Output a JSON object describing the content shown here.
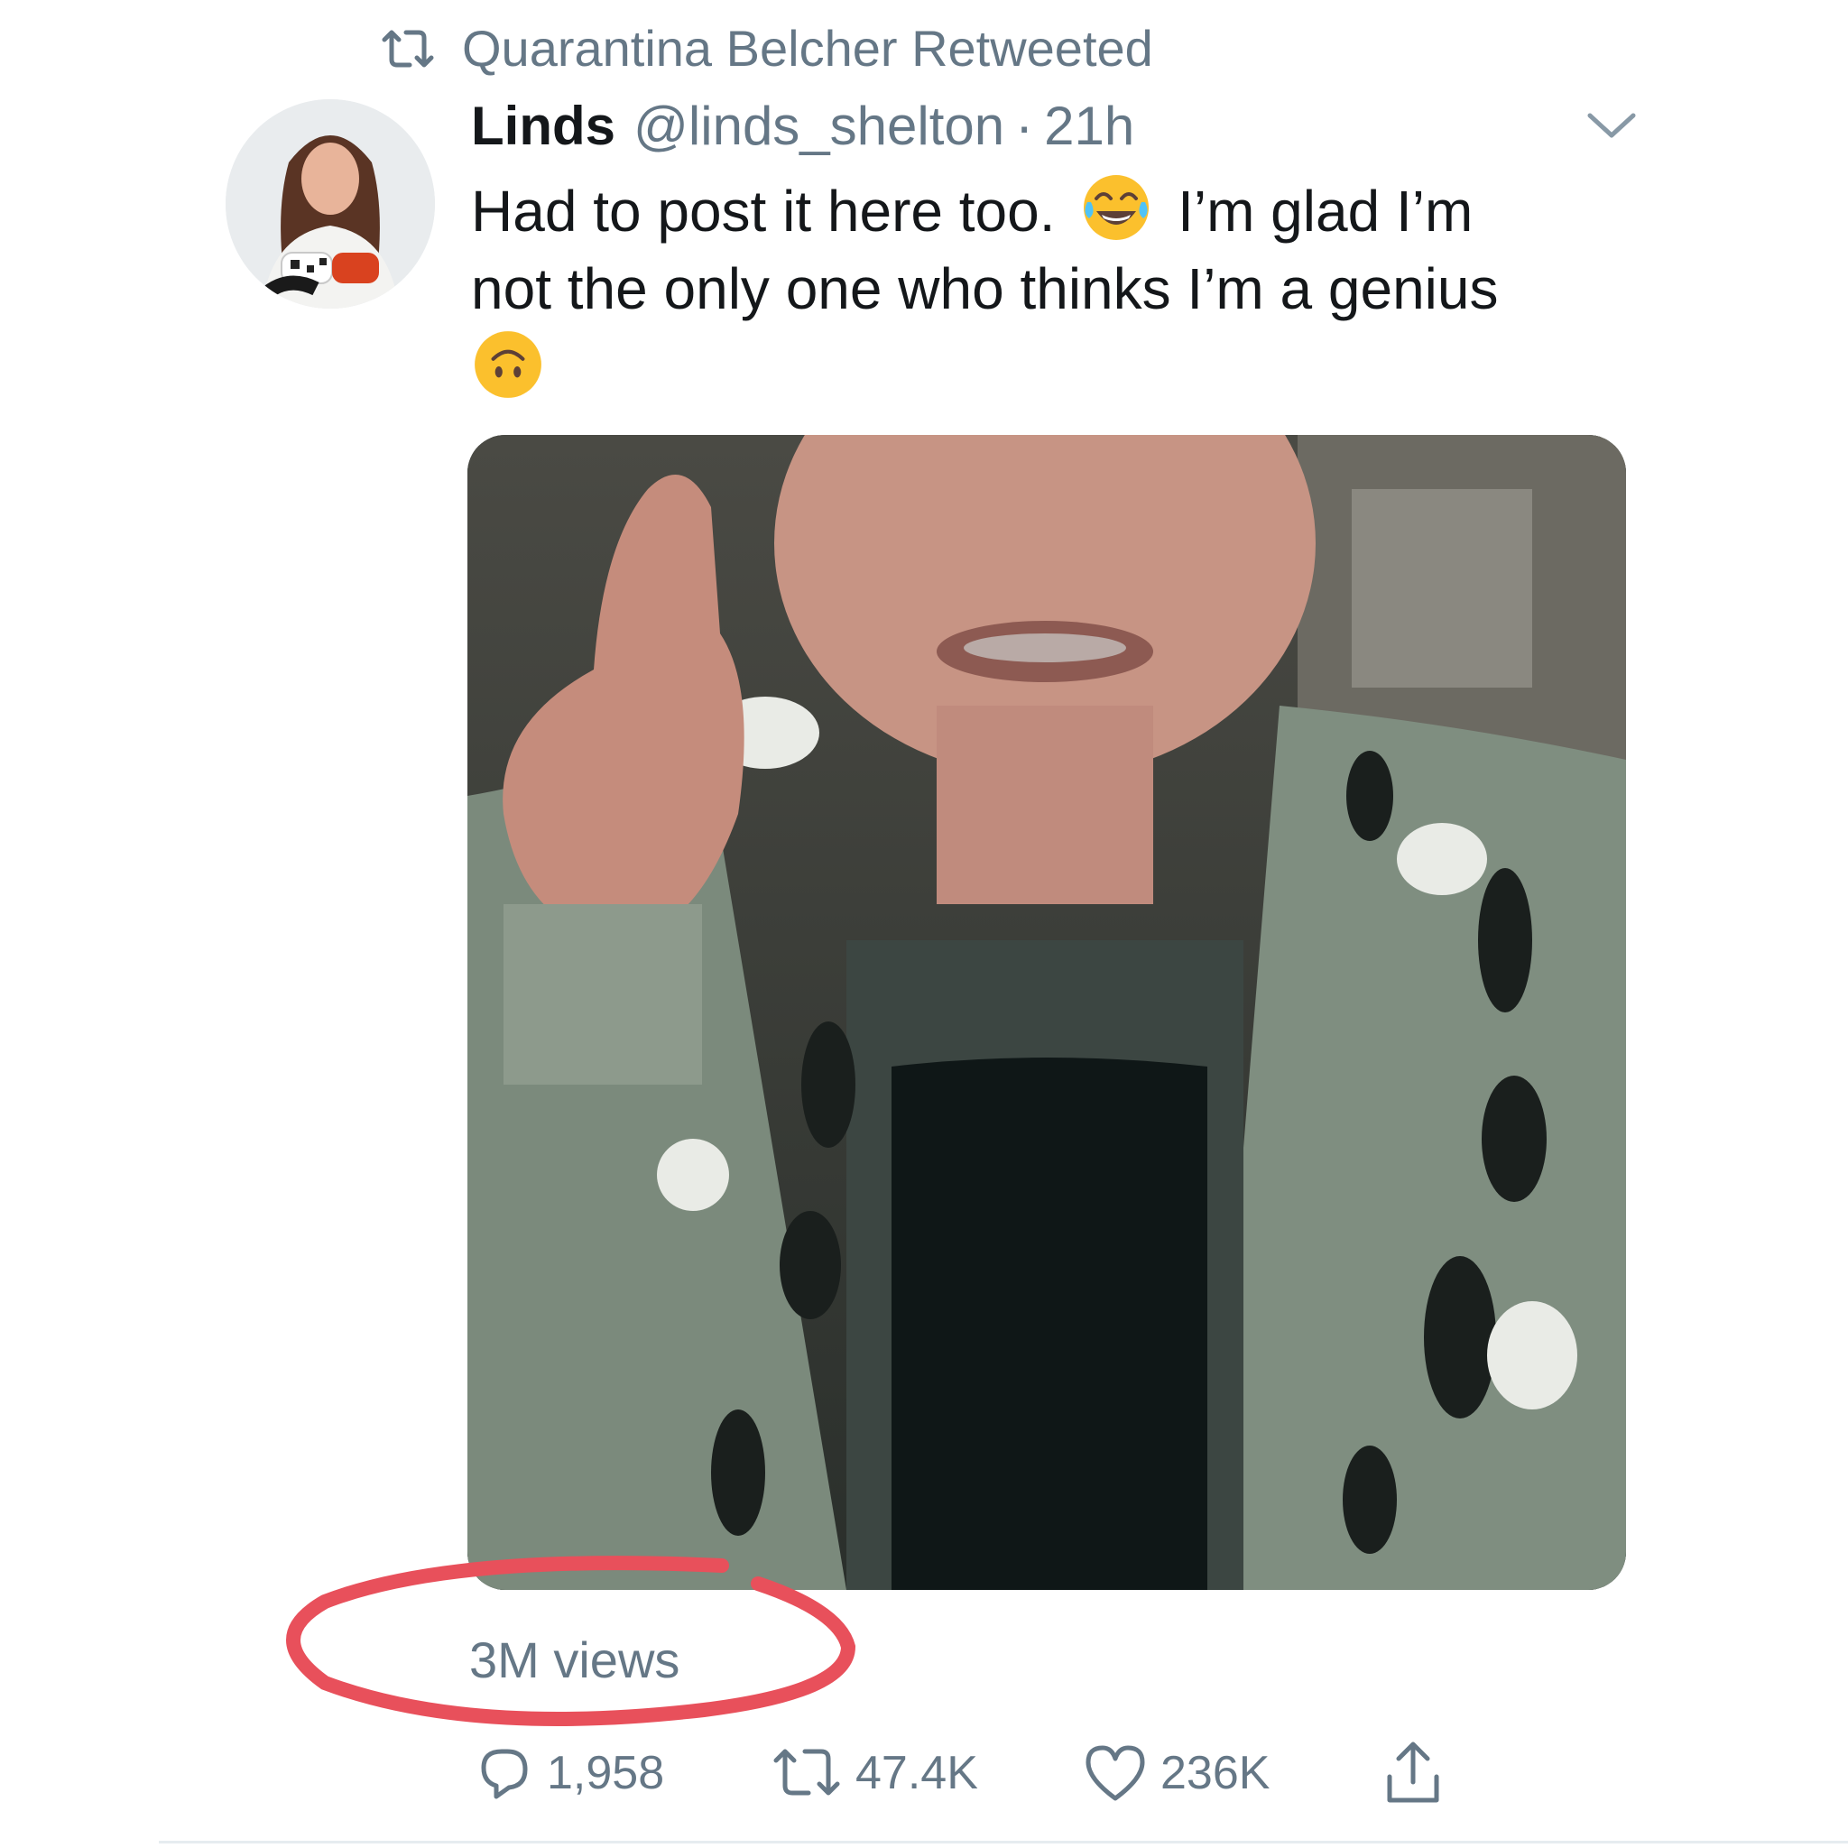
{
  "retweet_context": {
    "icon": "retweet-icon",
    "text": "Quarantina Belcher Retweeted"
  },
  "tweet": {
    "author_name": "Linds",
    "author_handle": "@linds_shelton",
    "separator": "·",
    "timestamp": "21h",
    "text_line1_a": "Had to post it here too.",
    "emoji_1": "face-with-tears-of-joy",
    "text_line1_b": "I’m glad I’m",
    "text_line2": "not the only one who thinks I’m a genius",
    "emoji_2": "upside-down-face",
    "media_type": "video",
    "views": "3M views"
  },
  "actions": {
    "replies": "1,958",
    "retweets": "47.4K",
    "likes": "236K"
  },
  "colors": {
    "secondary_text": "#657786",
    "primary_text": "#14171a",
    "annotation_red": "#e8505b"
  }
}
